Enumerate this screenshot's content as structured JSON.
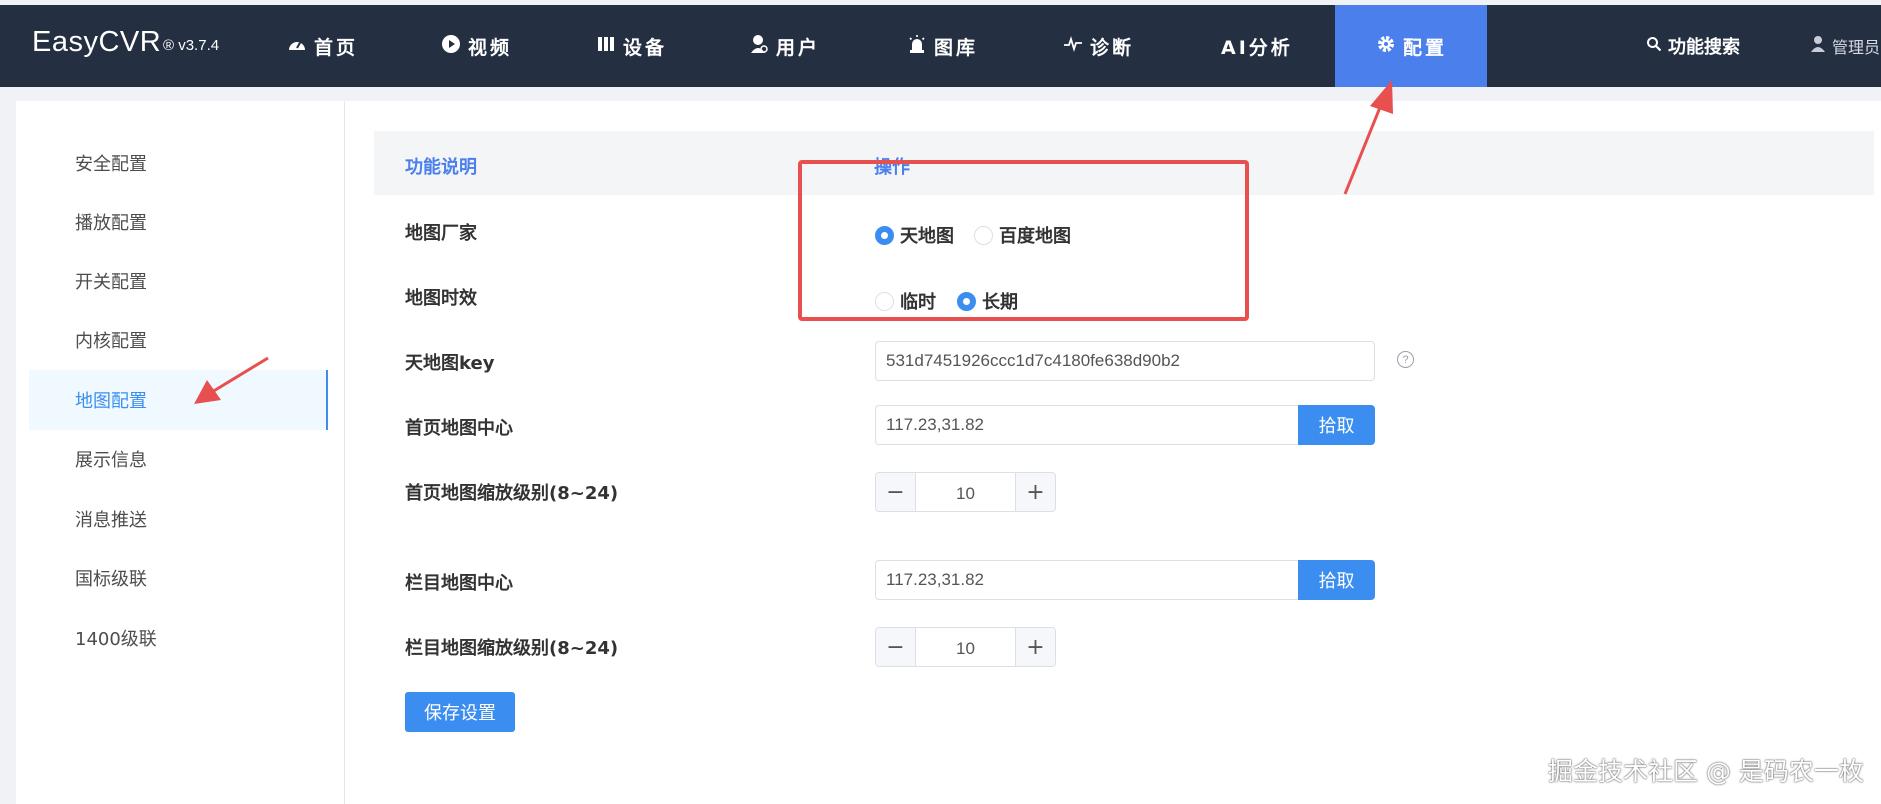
{
  "header": {
    "brand": "EasyCVR",
    "version": "® v3.7.4",
    "nav": [
      {
        "label": "首页",
        "icon": "dashboard-icon"
      },
      {
        "label": "视频",
        "icon": "play-circle-icon"
      },
      {
        "label": "设备",
        "icon": "device-icon"
      },
      {
        "label": "用户",
        "icon": "user-icon"
      },
      {
        "label": "图库",
        "icon": "alarm-icon"
      },
      {
        "label": "诊断",
        "icon": "pulse-icon"
      },
      {
        "label": "AI分析",
        "icon": ""
      },
      {
        "label": "配置",
        "icon": "gear-icon",
        "active": true
      }
    ],
    "search_label": "功能搜索",
    "user_label": "管理员"
  },
  "sidebar": {
    "items": [
      {
        "label": "安全配置"
      },
      {
        "label": "播放配置"
      },
      {
        "label": "开关配置"
      },
      {
        "label": "内核配置"
      },
      {
        "label": "地图配置",
        "active": true
      },
      {
        "label": "展示信息"
      },
      {
        "label": "消息推送"
      },
      {
        "label": "国标级联"
      },
      {
        "label": "1400级联"
      }
    ]
  },
  "table": {
    "col_desc": "功能说明",
    "col_op": "操作"
  },
  "form": {
    "map_vendor": {
      "label": "地图厂家",
      "options": [
        "天地图",
        "百度地图"
      ],
      "selected": "天地图"
    },
    "map_validity": {
      "label": "地图时效",
      "options": [
        "临时",
        "长期"
      ],
      "selected": "长期"
    },
    "tianditu_key": {
      "label": "天地图key",
      "value": "531d7451926ccc1d7c4180fe638d90b2",
      "help": "?"
    },
    "home_center": {
      "label": "首页地图中心",
      "value": "117.23,31.82",
      "button": "拾取"
    },
    "home_zoom": {
      "label": "首页地图缩放级别(8~24)",
      "value": "10"
    },
    "column_center": {
      "label": "栏目地图中心",
      "value": "117.23,31.82",
      "button": "拾取"
    },
    "column_zoom": {
      "label": "栏目地图缩放级别(8~24)",
      "value": "10"
    },
    "save_label": "保存设置"
  },
  "stepper_symbols": {
    "minus": "−",
    "plus": "+"
  },
  "watermark": "掘金技术社区 @ 是码农一枚",
  "colors": {
    "nav_bg": "#252f42",
    "nav_active": "#4a7fec",
    "primary": "#3b8ef0",
    "annotation": "#e8504f"
  }
}
